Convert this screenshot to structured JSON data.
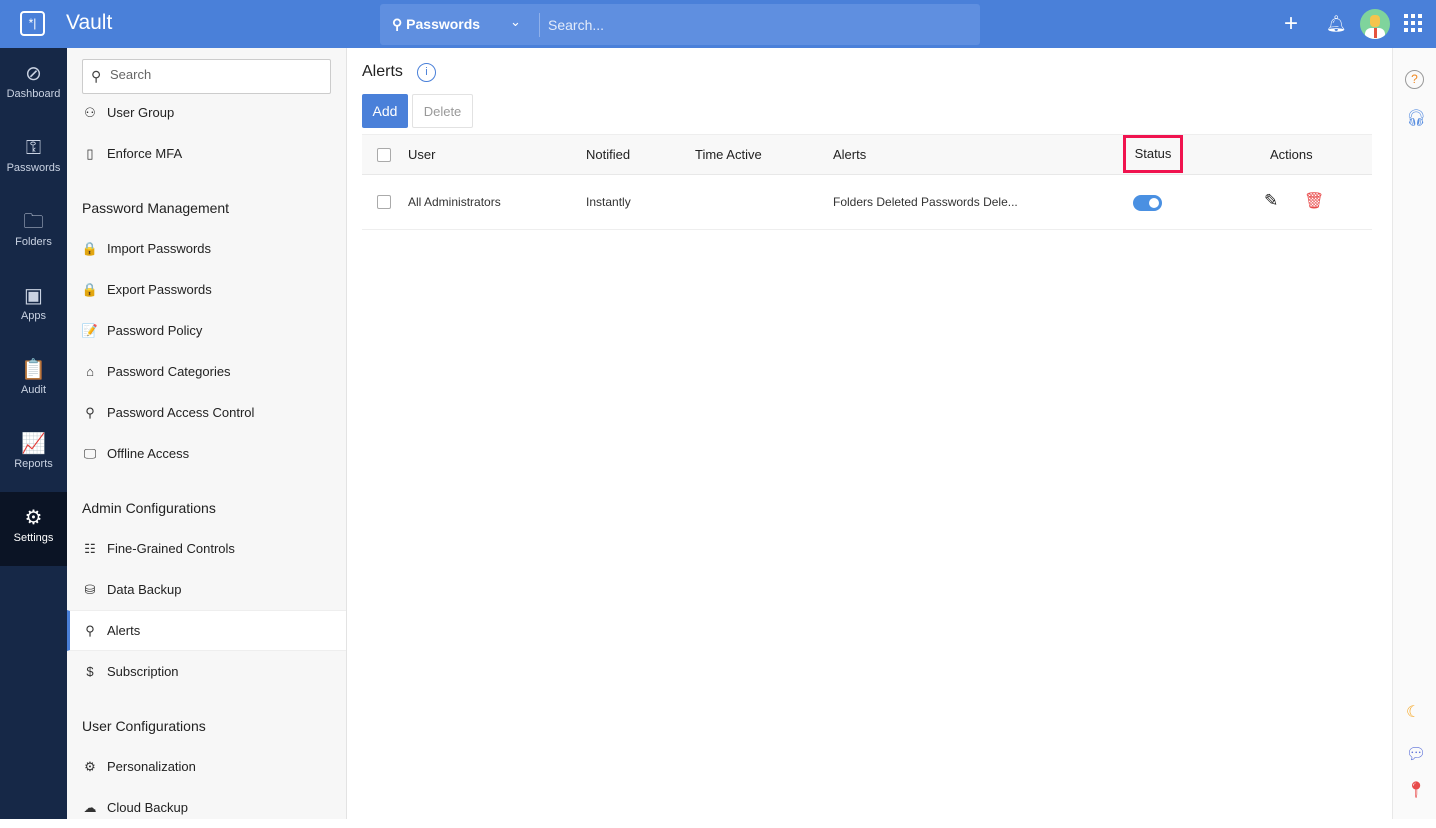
{
  "app": {
    "title": "Vault"
  },
  "search": {
    "scope": "Passwords",
    "placeholder": "Search..."
  },
  "rail": [
    {
      "label": "Dashboard",
      "icon": "compass-icon",
      "glyph": "⊘"
    },
    {
      "label": "Passwords",
      "icon": "key-icon",
      "glyph": "⚿"
    },
    {
      "label": "Folders",
      "icon": "folder-icon",
      "glyph": "🗀"
    },
    {
      "label": "Apps",
      "icon": "sso-icon",
      "glyph": "▣"
    },
    {
      "label": "Audit",
      "icon": "clipboard-icon",
      "glyph": "📋"
    },
    {
      "label": "Reports",
      "icon": "chart-icon",
      "glyph": "📈"
    },
    {
      "label": "Settings",
      "icon": "gear-icon",
      "glyph": "⚙",
      "active": true
    }
  ],
  "panel": {
    "search_placeholder": "Search",
    "entries": [
      {
        "type": "item",
        "label": "User Group",
        "icon": "user-group-icon",
        "glyph": "⚇"
      },
      {
        "type": "item",
        "label": "Enforce MFA",
        "icon": "mfa-device-icon",
        "glyph": "▯"
      },
      {
        "type": "head",
        "label": "Password Management"
      },
      {
        "type": "item",
        "label": "Import Passwords",
        "icon": "lock-import-icon",
        "glyph": "🔒"
      },
      {
        "type": "item",
        "label": "Export Passwords",
        "icon": "lock-export-icon",
        "glyph": "🔒"
      },
      {
        "type": "item",
        "label": "Password Policy",
        "icon": "policy-icon",
        "glyph": "📝"
      },
      {
        "type": "item",
        "label": "Password Categories",
        "icon": "categories-icon",
        "glyph": "⌂"
      },
      {
        "type": "item",
        "label": "Password Access Control",
        "icon": "access-control-icon",
        "glyph": "⚲"
      },
      {
        "type": "item",
        "label": "Offline Access",
        "icon": "offline-icon",
        "glyph": "🖵"
      },
      {
        "type": "head",
        "label": "Admin Configurations"
      },
      {
        "type": "item",
        "label": "Fine-Grained Controls",
        "icon": "sliders-icon",
        "glyph": "☷"
      },
      {
        "type": "item",
        "label": "Data Backup",
        "icon": "database-icon",
        "glyph": "⛁"
      },
      {
        "type": "item",
        "label": "Alerts",
        "icon": "user-alert-icon",
        "glyph": "⚲",
        "active": true
      },
      {
        "type": "item",
        "label": "Subscription",
        "icon": "subscription-icon",
        "glyph": "$"
      },
      {
        "type": "head",
        "label": "User Configurations"
      },
      {
        "type": "item",
        "label": "Personalization",
        "icon": "gear-icon",
        "glyph": "⚙"
      },
      {
        "type": "item",
        "label": "Cloud Backup",
        "icon": "cloud-icon",
        "glyph": "☁"
      }
    ]
  },
  "main": {
    "title": "Alerts",
    "add_label": "Add",
    "delete_label": "Delete",
    "columns": {
      "user": "User",
      "notified": "Notified",
      "time_active": "Time Active",
      "alerts": "Alerts",
      "status": "Status",
      "actions": "Actions"
    },
    "rows": [
      {
        "user": "All Administrators",
        "notified": "Instantly",
        "time_active": "",
        "alerts": "Folders Deleted Passwords Dele...",
        "status_on": true
      }
    ]
  }
}
